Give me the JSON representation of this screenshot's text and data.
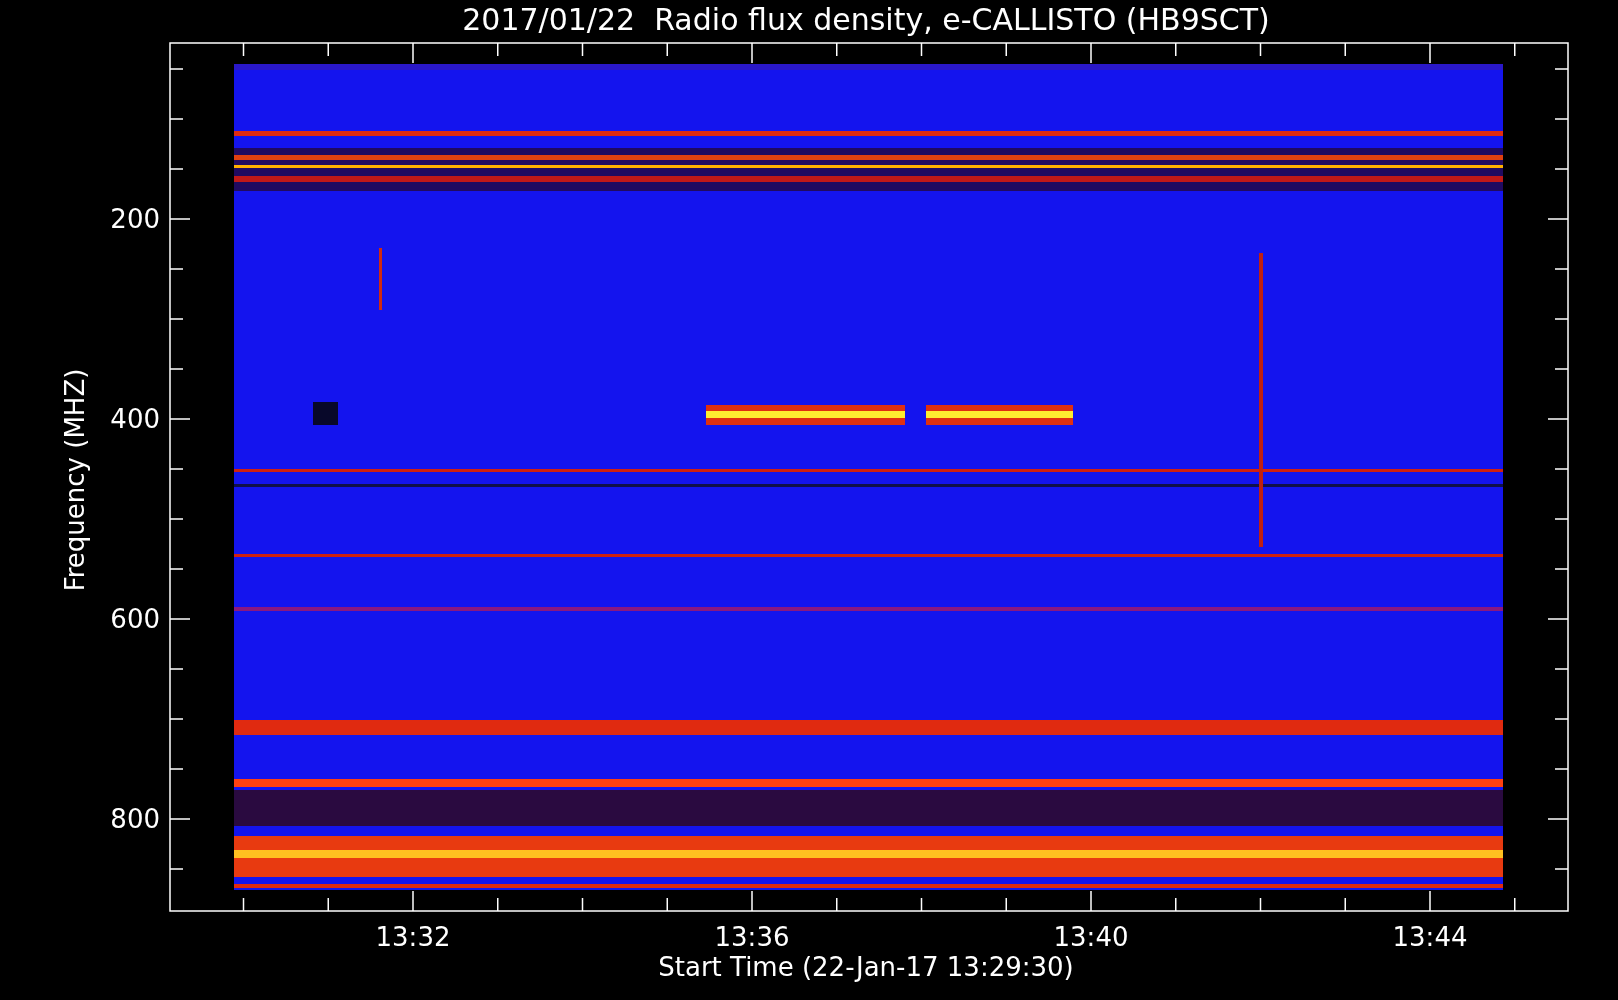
{
  "title": "2017/01/22  Radio flux density, e-CALLISTO (HB9SCT)",
  "plot": {
    "ylabel": "Frequency (MHZ)",
    "xlabel": "Start Time (22-Jan-17 13:29:30)",
    "yticks": [
      "200",
      "400",
      "600",
      "800"
    ],
    "xticks": [
      "13:32",
      "13:36",
      "13:40",
      "13:44"
    ]
  }
}
